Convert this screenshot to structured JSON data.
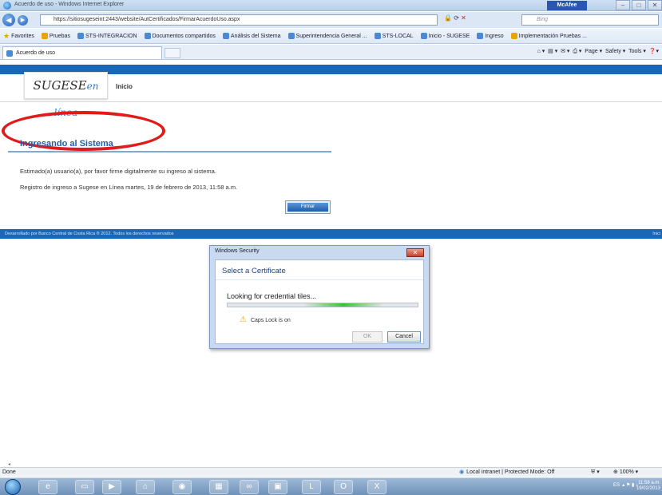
{
  "window": {
    "title": "Acuerdo de uso - Windows Internet Explorer",
    "mcafee": "McAfee",
    "controls": [
      "‒",
      "□",
      "✕"
    ]
  },
  "address": {
    "url": "https://sitiosugeseint:2443/website/AutCertificados/FirmarAcuerdoUso.aspx",
    "search_placeholder": "Bing"
  },
  "favorites": [
    "Favorites",
    "Pruebas",
    "STS-INTEGRACION",
    "Documentos compartidos",
    "Análisis del Sistema",
    "Superintendencia General ...",
    "STS-LOCAL",
    "Inicio - SUGESE",
    "Ingreso",
    "Implementación Pruebas ..."
  ],
  "tab": {
    "label": "Acuerdo de uso"
  },
  "commandbar": {
    "page": "Page ▾",
    "safety": "Safety ▾",
    "tools": "Tools ▾"
  },
  "site": {
    "logo_main": "SUGESE",
    "logo_accent": "en línea",
    "nav_inicio": "Inicio",
    "section_title": "Ingresando al Sistema",
    "paragraph1": "Estimado(a) usuario(a), por favor firme digitalmente su ingreso al sistema.",
    "paragraph2": "Registro de ingreso a Sugese en Línea martes, 19 de febrero de 2013, 11:58 a.m.",
    "firmar_button": "Firmar",
    "footer": "Desarrollado por Banco Central de Costa Rica ® 2012. Todos los derechos reservados",
    "footer_right": "Inici"
  },
  "dialog": {
    "window_title": "Windows Security",
    "heading": "Select a Certificate",
    "looking": "Looking for credential tiles...",
    "progress": 0.4,
    "caps_lock": "Caps Lock is on",
    "ok": "OK",
    "cancel": "Cancel"
  },
  "status": {
    "done": "Done",
    "zone": "Local intranet | Protected Mode: Off",
    "zoom": "100%"
  },
  "taskbar": {
    "language": "ES",
    "time": "11:58 a.m.",
    "date": "19/02/2013"
  },
  "colors": {
    "brand_blue": "#1a67b5",
    "title_blue": "#1f5fa6",
    "annotation_red": "#e11a1a"
  }
}
